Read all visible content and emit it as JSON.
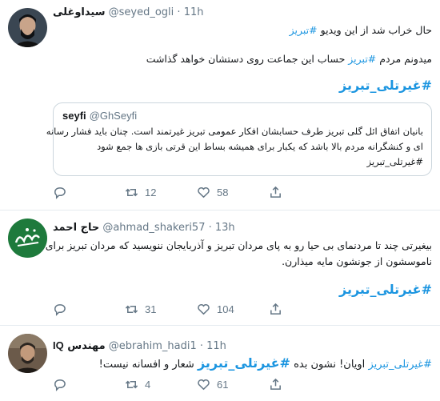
{
  "tweets": [
    {
      "name": "سیداوغلی",
      "handle": "@seyed_ogli",
      "time": "11h",
      "line1": {
        "text": "حال خراب شد از این ویدیو ",
        "tag": "#تبریز"
      },
      "line2": {
        "pre": "میدونم مردم ",
        "tag": "#تبریز",
        "post": " حساب این جماعت روی دستشان خواهد گذاشت"
      },
      "hashtag": "#غیرتلی_تبریز",
      "quote": {
        "name": "seyfi",
        "handle": "@GhSeyfi",
        "line1": "بانیان اتفاق ائل گلی تبریز طرف حسابشان افکار عمومی تبریز غیرتمند است. چنان باید فشار رسانه",
        "line2": "ای و کنشگرانه مردم بالا باشد که یکبار برای همیشه بساط این قرتی بازی ها جمع شود",
        "tag": "#غیرتلی_تبریز"
      },
      "actions": {
        "replies": "",
        "retweets": "12",
        "likes": "58"
      },
      "avatar_colors": {
        "bg": "#3a4652",
        "fg": "#0f1114"
      }
    },
    {
      "name": "حاج احمد",
      "handle": "@ahmad_shakeri57",
      "time": "13h",
      "line1": "بیغیرتی چند تا مردنمای بی حیا رو به پای مردان تبریز و آذربایجان ننویسید که مردان تبریز برای",
      "line2": "ناموسشون از جونشون مایه میذارن.",
      "hashtag": "#غیرتلی_تبریز",
      "actions": {
        "replies": "",
        "retweets": "31",
        "likes": "104"
      },
      "avatar_colors": {
        "bg": "#1e7a3c",
        "fg": "#ffffff"
      }
    },
    {
      "name": "مهندس",
      "name_latin": "IQ",
      "handle": "@ebrahim_hadi1",
      "time": "11h",
      "line": {
        "tag1": "#غیرتلی_تبریز",
        "mid": " اویان! نشون بده ",
        "tag2": "#غیرتلی_تبریز",
        "post": " شعار و افسانه نیست!"
      },
      "actions": {
        "replies": "",
        "retweets": "4",
        "likes": "61"
      },
      "avatar_colors": {
        "bg": "#6b5a4a",
        "fg": "#2b2520"
      }
    }
  ],
  "separator": " · "
}
